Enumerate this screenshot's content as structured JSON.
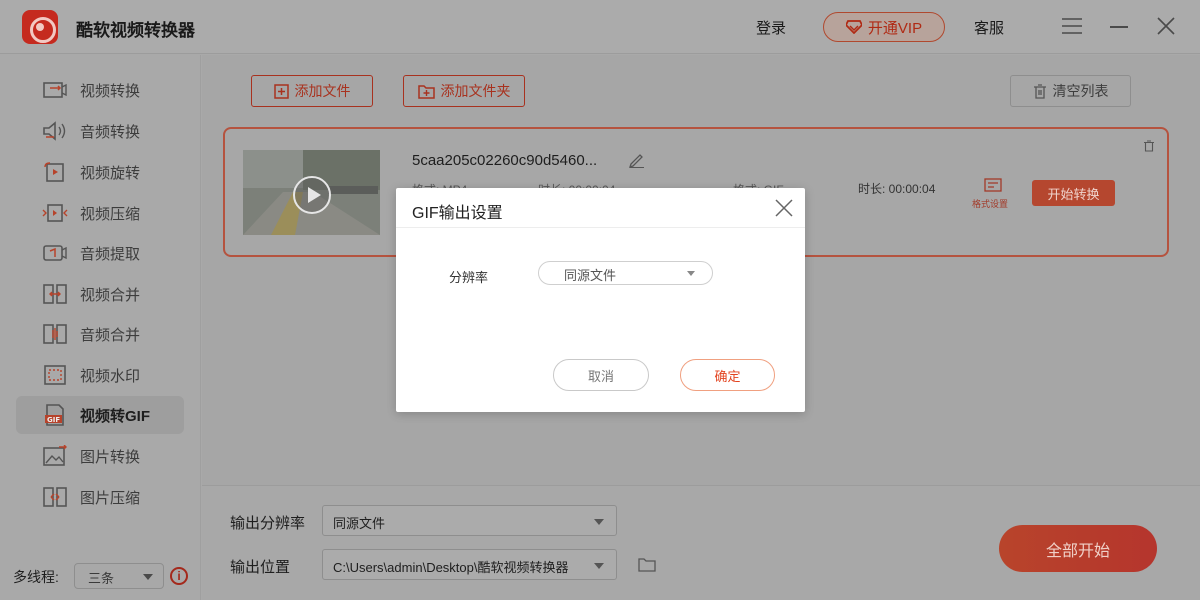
{
  "app": {
    "title": "酷软视频转换器"
  },
  "header": {
    "login": "登录",
    "vip": "开通VIP",
    "service": "客服"
  },
  "sidebar": {
    "items": [
      {
        "label": "视频转换",
        "icon": "video-convert-icon"
      },
      {
        "label": "音频转换",
        "icon": "audio-convert-icon"
      },
      {
        "label": "视频旋转",
        "icon": "video-rotate-icon"
      },
      {
        "label": "视频压缩",
        "icon": "video-compress-icon"
      },
      {
        "label": "音频提取",
        "icon": "audio-extract-icon"
      },
      {
        "label": "视频合并",
        "icon": "video-merge-icon"
      },
      {
        "label": "音频合并",
        "icon": "audio-merge-icon"
      },
      {
        "label": "视频水印",
        "icon": "video-watermark-icon"
      },
      {
        "label": "视频转GIF",
        "icon": "gif-icon",
        "active": true
      },
      {
        "label": "图片转换",
        "icon": "image-convert-icon"
      },
      {
        "label": "图片压缩",
        "icon": "image-compress-icon"
      }
    ],
    "threads_label": "多线程:",
    "threads_value": "三条"
  },
  "toolbar": {
    "add_file": "添加文件",
    "add_folder": "添加文件夹",
    "clear_list": "清空列表"
  },
  "file_card": {
    "name": "5caa205c02260c90d5460...",
    "format_in": "格式: MP4",
    "duration_in": "时长: 00:00:04",
    "format_out": "格式: GIF",
    "duration_out": "时长: 00:00:04",
    "format_settings": "格式设置",
    "start_convert": "开始转换"
  },
  "bottom": {
    "resolution_label": "输出分辨率",
    "resolution_value": "同源文件",
    "location_label": "输出位置",
    "location_value": "C:\\Users\\admin\\Desktop\\酷软视频转换器",
    "start_all": "全部开始"
  },
  "dialog": {
    "title": "GIF输出设置",
    "resolution_label": "分辨率",
    "resolution_value": "同源文件",
    "cancel": "取消",
    "confirm": "确定"
  },
  "colors": {
    "accent": "#e2431f",
    "brand": "#c52a1f"
  }
}
